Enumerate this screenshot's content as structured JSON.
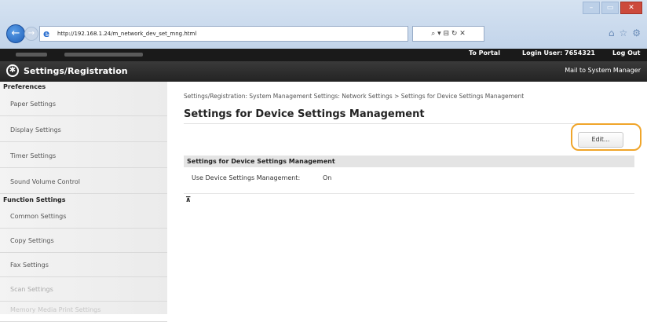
{
  "browser": {
    "url": "http://192.168.1.24/m_network_dev_set_mng.html",
    "address_tools": "⌕ ▾ ⊟ ↻ ✕",
    "window_controls": [
      "–",
      "▭",
      "✕"
    ]
  },
  "header": {
    "to_portal": "To Portal",
    "login_user_label": "Login User:",
    "login_user_value": "7654321",
    "logout": "Log Out",
    "app_title": "Settings/Registration",
    "mail_link": "Mail to System Manager"
  },
  "sidebar": {
    "preferences_heading": "Preferences",
    "preferences_items": [
      {
        "label": "Paper Settings"
      },
      {
        "label": "Display Settings"
      },
      {
        "label": "Timer Settings"
      },
      {
        "label": "Sound Volume Control"
      }
    ],
    "function_heading": "Function Settings",
    "function_items": [
      {
        "label": "Common Settings"
      },
      {
        "label": "Copy Settings"
      },
      {
        "label": "Fax Settings"
      },
      {
        "label": "Scan Settings"
      },
      {
        "label": "Memory Media Print Settings"
      }
    ]
  },
  "main": {
    "breadcrumb": "Settings/Registration: System Management Settings: Network Settings > Settings for Device Settings Management",
    "page_title": "Settings for Device Settings Management",
    "edit_button": "Edit...",
    "section_title": "Settings for Device Settings Management",
    "rows": [
      {
        "label": "Use Device Settings Management:",
        "value": "On"
      }
    ],
    "back_to_top": "⊼"
  },
  "colors": {
    "highlight": "#f0a52a",
    "header_bg": "#1a1a1a",
    "sidebar_bg": "#f0f0f0"
  }
}
